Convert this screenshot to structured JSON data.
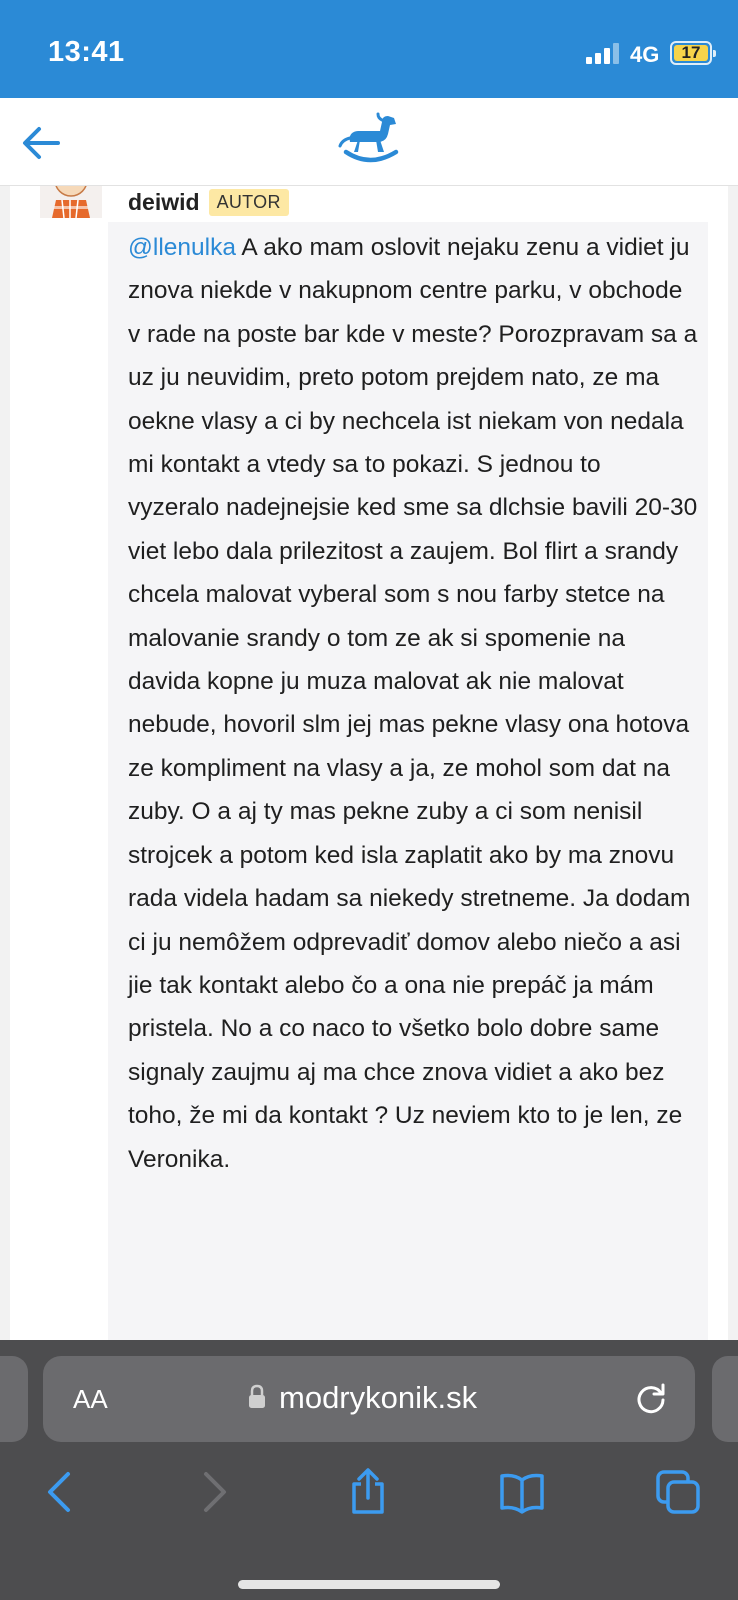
{
  "status_bar": {
    "time": "13:41",
    "network": "4G",
    "battery_level": "17",
    "battery_color": "#f7d44a",
    "background": "#2b8ad6"
  },
  "app_bar": {
    "back_icon": "arrow-left-icon",
    "logo_icon": "rocking-horse-logo",
    "accent": "#2b8ad6"
  },
  "post": {
    "author": "deiwid",
    "author_badge": "AUTOR",
    "mention": "@llenulka",
    "body": " A ako mam oslovit nejaku zenu a vidiet ju znova niekde v nakupnom centre parku, v obchode v rade na poste bar kde v meste? Porozpravam sa a uz ju neuvidim, preto potom prejdem nato, ze ma oekne vlasy a ci by nechcela ist niekam von nedala mi kontakt a vtedy sa to pokazi. S jednou to vyzeralo nadejnejsie ked sme sa dlchsie bavili 20-30 viet lebo dala prilezitost a zaujem. Bol flirt a srandy chcela malovat vyberal som s nou farby stetce na malovanie srandy o tom ze ak si spomenie na davida kopne ju muza malovat ak nie malovat nebude, hovoril slm jej mas pekne vlasy ona hotova ze kompliment na vlasy a ja, ze mohol som dat na zuby. O a aj ty mas pekne zuby a ci som nenisil strojcek a potom ked isla zaplatit ako by ma znovu rada videla hadam sa niekedy stretneme. Ja dodam ci ju nemôžem odprevadiť domov alebo niečo a asi jie tak kontakt alebo čo a ona nie prepáč ja mám pristela. No a co naco to všetko bolo dobre same signaly zaujmu aj ma chce znova vidiet a ako bez toho, že mi da kontakt ? Uz neviem kto to je len, ze Veronika."
  },
  "browser": {
    "text_size_label": "AA",
    "domain": "modrykonik.sk",
    "reload_icon": "reload-icon",
    "lock_icon": "lock-icon",
    "toolbar_icons": [
      "chevron-left-icon",
      "chevron-right-icon",
      "share-icon",
      "bookmarks-icon",
      "tabs-icon"
    ]
  }
}
